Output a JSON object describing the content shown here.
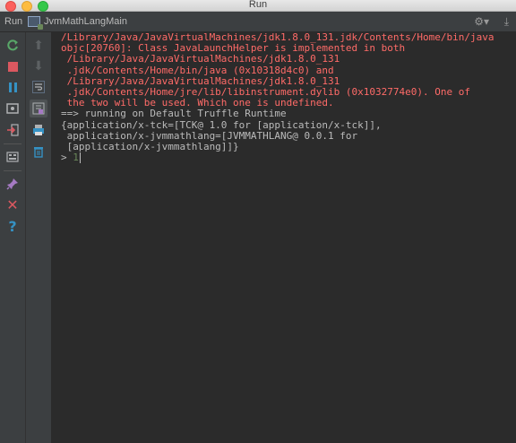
{
  "window": {
    "title": "Run"
  },
  "tool_header": {
    "run_label": "Run",
    "config_name": "JvmMathLangMain"
  },
  "console": {
    "error_lines": [
      "/Library/Java/JavaVirtualMachines/jdk1.8.0_131.jdk/Contents/Home/bin/java",
      "objc[20760]: Class JavaLaunchHelper is implemented in both",
      " /Library/Java/JavaVirtualMachines/jdk1.8.0_131",
      " .jdk/Contents/Home/bin/java (0x10318d4c0) and",
      " /Library/Java/JavaVirtualMachines/jdk1.8.0_131",
      " .jdk/Contents/Home/jre/lib/libinstrument.dylib (0x1032774e0). One of",
      " the two will be used. Which one is undefined."
    ],
    "output_lines": [
      "==> running on Default Truffle Runtime",
      "{application/x-tck=[TCK@ 1.0 for [application/x-tck]],",
      " application/x-jvmmathlang=[JVMMATHLANG@ 0.0.1 for",
      " [application/x-jvmmathlang]]}"
    ],
    "prompt": "> ",
    "input_value": "1"
  }
}
